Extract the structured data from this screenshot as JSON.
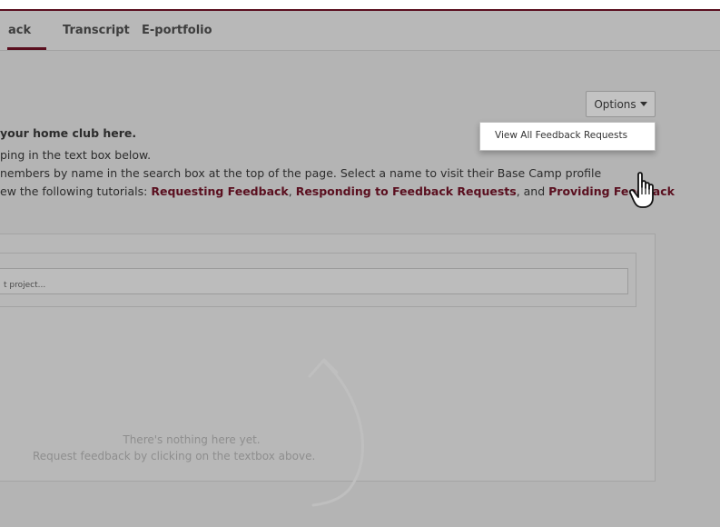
{
  "tabs": [
    {
      "label": "ack",
      "active": true
    },
    {
      "label": "Transcript",
      "active": false
    },
    {
      "label": "E-portfolio",
      "active": false
    }
  ],
  "toolbar": {
    "options_label": "Options"
  },
  "dropdown": {
    "items": [
      "View All Feedback Requests"
    ]
  },
  "intro": {
    "line1_bold": "your home club here.",
    "line2": "ping in the text box below.",
    "line3": "nembers by name in the search box at the top of the page. Select a name to visit their Base Camp profile",
    "line4_prefix": "ew the following tutorials: ",
    "link1": "Requesting Feedback",
    "sep1": ", ",
    "link2": "Responding to Feedback Requests",
    "sep2": ", and ",
    "link3": "Providing Feedback"
  },
  "feedback_input": {
    "placeholder": "t project..."
  },
  "empty_state": {
    "line1": "There's nothing here yet.",
    "line2": "Request feedback by clicking on the textbox above."
  },
  "colors": {
    "brand": "#5a0f1f",
    "background": "#b4b4b4"
  }
}
